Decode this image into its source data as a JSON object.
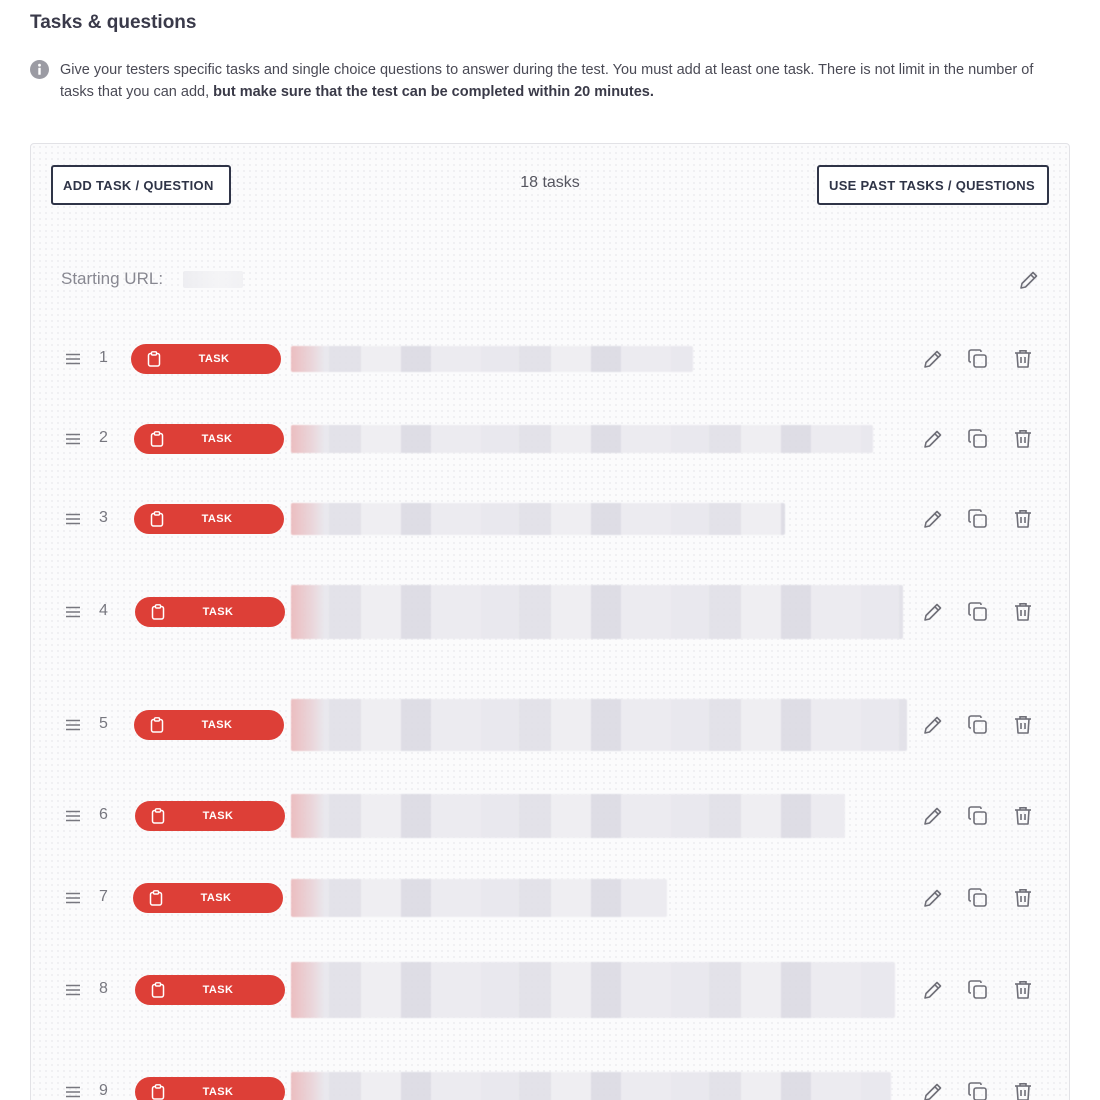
{
  "section": {
    "title": "Tasks & questions",
    "info_prefix": "Give your testers specific tasks and single choice questions to answer during the test. You must add at least one task. There is not limit in the number of tasks that you can add, ",
    "info_bold": "but make sure that the test can be completed within 20 minutes."
  },
  "toolbar": {
    "add_label": "ADD TASK / QUESTION",
    "count_label": "18 tasks",
    "past_label": "USE PAST TASKS / QUESTIONS"
  },
  "starting_url": {
    "label": "Starting URL:",
    "edit_icon": "pencil-icon"
  },
  "colors": {
    "accent": "#dd3f37",
    "button_border": "#2f3447"
  },
  "icons": {
    "drag": "drag-handle-icon",
    "clipboard": "clipboard-icon",
    "edit": "pencil-icon",
    "duplicate": "copy-icon",
    "delete": "trash-icon",
    "info": "info-icon"
  },
  "tasks": [
    {
      "number": "1",
      "type": "TASK"
    },
    {
      "number": "2",
      "type": "TASK"
    },
    {
      "number": "3",
      "type": "TASK"
    },
    {
      "number": "4",
      "type": "TASK"
    },
    {
      "number": "5",
      "type": "TASK"
    },
    {
      "number": "6",
      "type": "TASK"
    },
    {
      "number": "7",
      "type": "TASK"
    },
    {
      "number": "8",
      "type": "TASK"
    },
    {
      "number": "9",
      "type": "TASK"
    }
  ]
}
